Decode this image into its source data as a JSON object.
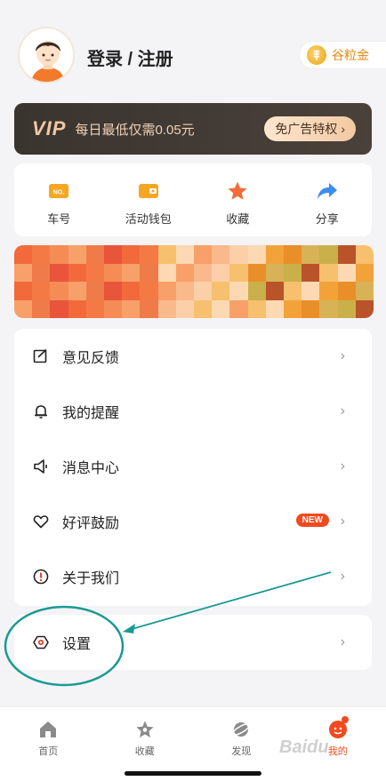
{
  "header": {
    "login_label": "登录 / 注册",
    "gold_label": "谷粒金"
  },
  "vip": {
    "logo": "VIP",
    "text": "每日最低仅需0.05元",
    "button_label": "免广告特权",
    "chevron": "›"
  },
  "quick": [
    {
      "label": "车号",
      "icon": "no-plate-icon"
    },
    {
      "label": "活动钱包",
      "icon": "wallet-icon"
    },
    {
      "label": "收藏",
      "icon": "star-icon"
    },
    {
      "label": "分享",
      "icon": "share-icon"
    }
  ],
  "menu": [
    {
      "label": "意见反馈",
      "icon": "feedback-icon"
    },
    {
      "label": "我的提醒",
      "icon": "bell-icon"
    },
    {
      "label": "消息中心",
      "icon": "speaker-icon"
    },
    {
      "label": "好评鼓励",
      "icon": "heart-icon",
      "badge": "NEW"
    },
    {
      "label": "关于我们",
      "icon": "info-icon"
    }
  ],
  "settings": {
    "label": "设置",
    "icon": "gear-icon"
  },
  "chevron": "›",
  "tabs": [
    {
      "label": "首页",
      "icon": "home-icon"
    },
    {
      "label": "收藏",
      "icon": "star-icon"
    },
    {
      "label": "发现",
      "icon": "planet-icon"
    },
    {
      "label": "我的",
      "icon": "profile-icon",
      "active": true
    }
  ],
  "watermark": "Baidu",
  "colors": {
    "accent": "#f04a1e",
    "vip_bg": "#3a342f",
    "annotation": "#1a9a93"
  }
}
